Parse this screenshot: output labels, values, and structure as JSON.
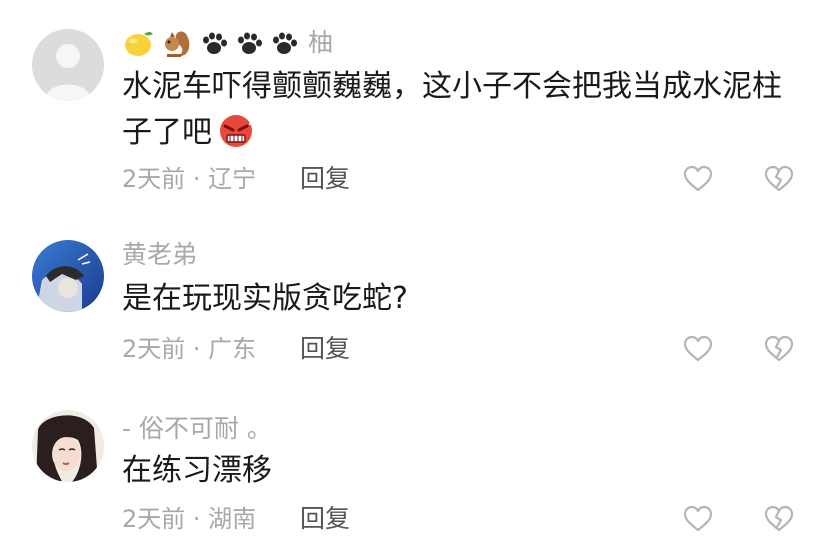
{
  "comments": [
    {
      "name_prefix_icons": [
        "lemon-icon",
        "squirrel-icon",
        "paw-icon",
        "paw-icon",
        "paw-icon"
      ],
      "name": "柚",
      "text_line1": "水泥车吓得颤颤巍巍，这小子不会把我当成水泥柱",
      "text_line2": "子了吧",
      "text_emoji": "angry-face-icon",
      "meta": "2天前 · 辽宁",
      "reply": "回复"
    },
    {
      "name": "黄老弟",
      "text": "是在玩现实版贪吃蛇?",
      "meta": "2天前 · 广东",
      "reply": "回复"
    },
    {
      "name": "-   俗不可耐 。",
      "text": "在练习漂移",
      "meta": "2天前 · 湖南",
      "reply": "回复"
    }
  ],
  "colors": {
    "meta_gray": "#a8a8a8",
    "body_text": "#1a1a1a",
    "icon_stroke": "#b5b5b5"
  }
}
